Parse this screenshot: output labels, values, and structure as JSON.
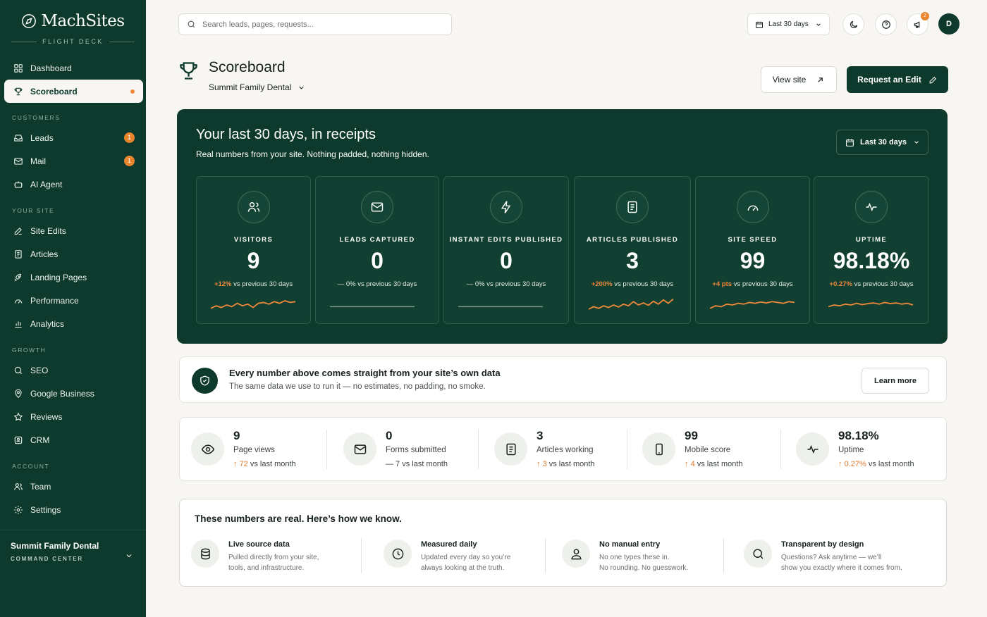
{
  "brand": {
    "name": "MachSites",
    "tagline": "FLIGHT DECK"
  },
  "colors": {
    "primary": "#0e3a2d",
    "accent": "#f0893a",
    "background": "#f7f6f2"
  },
  "sidebar": {
    "dashboard": "Dashboard",
    "scoreboard": "Scoreboard",
    "sec_customers": "CUSTOMERS",
    "leads": "Leads",
    "leads_badge": "1",
    "mail": "Mail",
    "mail_badge": "1",
    "ai_agent": "AI Agent",
    "sec_site": "YOUR SITE",
    "site_edits": "Site Edits",
    "articles": "Articles",
    "landing_pages": "Landing Pages",
    "performance": "Performance",
    "analytics": "Analytics",
    "sec_growth": "GROWTH",
    "seo": "SEO",
    "google_business": "Google Business",
    "reviews": "Reviews",
    "crm": "CRM",
    "sec_account": "ACCOUNT",
    "team": "Team",
    "settings": "Settings",
    "footer_title": "Summit Family Dental",
    "footer_sub": "COMMAND CENTER"
  },
  "topbar": {
    "search_placeholder": "Search leads, pages, requests...",
    "date_range": "Last 30 days",
    "notif_count": "2",
    "avatar_initial": "D"
  },
  "header": {
    "title": "Scoreboard",
    "practice": "Summit Family Dental",
    "view_site": "View site",
    "request_edit": "Request an Edit"
  },
  "hero": {
    "title": "Your last 30 days, in receipts",
    "subtitle": "Real numbers from your site. Nothing padded, nothing hidden.",
    "date_range": "Last 30 days",
    "cards": [
      {
        "label": "VISITORS",
        "value": "9",
        "delta": "+12%",
        "suffix": " vs previous 30 days",
        "spark": [
          0.3,
          0.45,
          0.35,
          0.5,
          0.4,
          0.6,
          0.45,
          0.55,
          0.35,
          0.6,
          0.65,
          0.55,
          0.7,
          0.6,
          0.75,
          0.65,
          0.7
        ]
      },
      {
        "label": "LEADS CAPTURED",
        "value": "0",
        "delta": "",
        "suffix": "— 0% vs previous 30 days",
        "spark": []
      },
      {
        "label": "INSTANT EDITS PUBLISHED",
        "value": "0",
        "delta": "",
        "suffix": "— 0% vs previous 30 days",
        "spark": []
      },
      {
        "label": "ARTICLES PUBLISHED",
        "value": "3",
        "delta": "+200%",
        "suffix": " vs previous 30 days",
        "spark": [
          0.25,
          0.4,
          0.3,
          0.45,
          0.35,
          0.5,
          0.38,
          0.55,
          0.45,
          0.7,
          0.5,
          0.62,
          0.48,
          0.72,
          0.55,
          0.8,
          0.6,
          0.85
        ]
      },
      {
        "label": "SITE SPEED",
        "value": "99",
        "delta": "+4 pts",
        "suffix": " vs previous 30 days",
        "spark": [
          0.3,
          0.45,
          0.4,
          0.55,
          0.5,
          0.6,
          0.55,
          0.65,
          0.6,
          0.68,
          0.62,
          0.7,
          0.65,
          0.6,
          0.7,
          0.65
        ]
      },
      {
        "label": "UPTIME",
        "value": "98.18%",
        "delta": "+0.27%",
        "suffix": " vs previous 30 days",
        "spark": [
          0.4,
          0.5,
          0.45,
          0.55,
          0.5,
          0.6,
          0.52,
          0.58,
          0.62,
          0.55,
          0.65,
          0.58,
          0.62,
          0.55,
          0.6,
          0.5
        ]
      }
    ]
  },
  "trust": {
    "title": "Every number above comes straight from your site’s own data",
    "subtitle": "The same data we use to run it — no estimates, no padding, no smoke.",
    "button": "Learn more"
  },
  "stats": [
    {
      "value": "9",
      "label": "Page views",
      "arrow": "↑",
      "delta": "72",
      "suffix": " vs last month"
    },
    {
      "value": "0",
      "label": "Forms submitted",
      "arrow": "",
      "delta": "",
      "suffix": "— 7 vs last month"
    },
    {
      "value": "3",
      "label": "Articles working",
      "arrow": "↑",
      "delta": "3",
      "suffix": " vs last month"
    },
    {
      "value": "99",
      "label": "Mobile score",
      "arrow": "↑",
      "delta": "4",
      "suffix": " vs last month"
    },
    {
      "value": "98.18%",
      "label": "Uptime",
      "arrow": "↑",
      "delta": "0.27%",
      "suffix": " vs last month"
    }
  ],
  "real": {
    "title": "These numbers are real. Here’s how we know.",
    "items": [
      {
        "title": "Live source data",
        "desc1": "Pulled directly from your site,",
        "desc2": "tools, and infrastructure."
      },
      {
        "title": "Measured daily",
        "desc1": "Updated every day so you’re",
        "desc2": "always looking at the truth."
      },
      {
        "title": "No manual entry",
        "desc1": "No one types these in.",
        "desc2": "No rounding. No guesswork."
      },
      {
        "title": "Transparent by design",
        "desc1": "Questions? Ask anytime — we’ll",
        "desc2": "show you exactly where it comes from."
      }
    ]
  }
}
